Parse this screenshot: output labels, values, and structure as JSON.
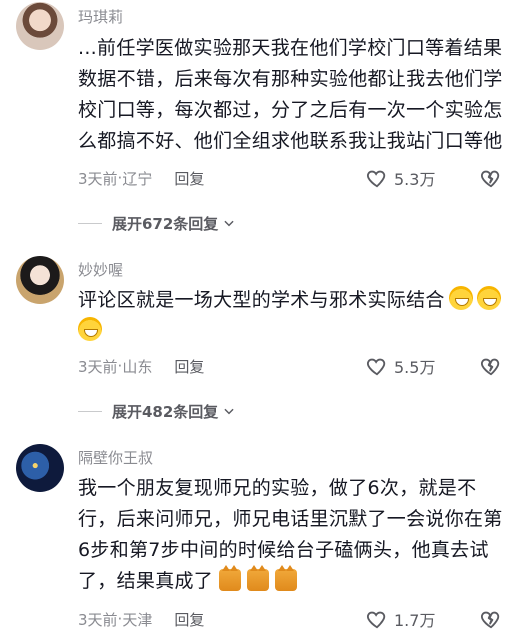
{
  "comments": [
    {
      "username": "玛琪莉",
      "text": "...前任学医做实验那天我在他们学校门口等着结果数据不错，后来每次有那种实验他都让我去他们学校门口等，每次都过，分了之后有一次一个实验怎么都搞不好、他们全组求他联系我让我站门口等他",
      "time": "3天前",
      "location": "辽宁",
      "reply_label": "回复",
      "likes": "5.3万",
      "expand_label": "展开672条回复"
    },
    {
      "username": "妙妙喔",
      "text": "评论区就是一场大型的学术与邪术实际结合",
      "emojis": [
        "grin-emoji",
        "grin-emoji",
        "grin-emoji"
      ],
      "time": "3天前",
      "location": "山东",
      "reply_label": "回复",
      "likes": "5.5万",
      "expand_label": "展开482条回复"
    },
    {
      "username": "隔壁你王叔",
      "text": "我一个朋友复现师兄的实验，做了6次，就是不行，后来问师兄，师兄电话里沉默了一会说你在第6步和第7步中间的时候给台子磕俩头，他真去试了，结果真成了",
      "emojis": [
        "cat-emoji",
        "cat-emoji",
        "cat-emoji"
      ],
      "time": "3天前",
      "location": "天津",
      "reply_label": "回复",
      "likes": "1.7万"
    }
  ]
}
